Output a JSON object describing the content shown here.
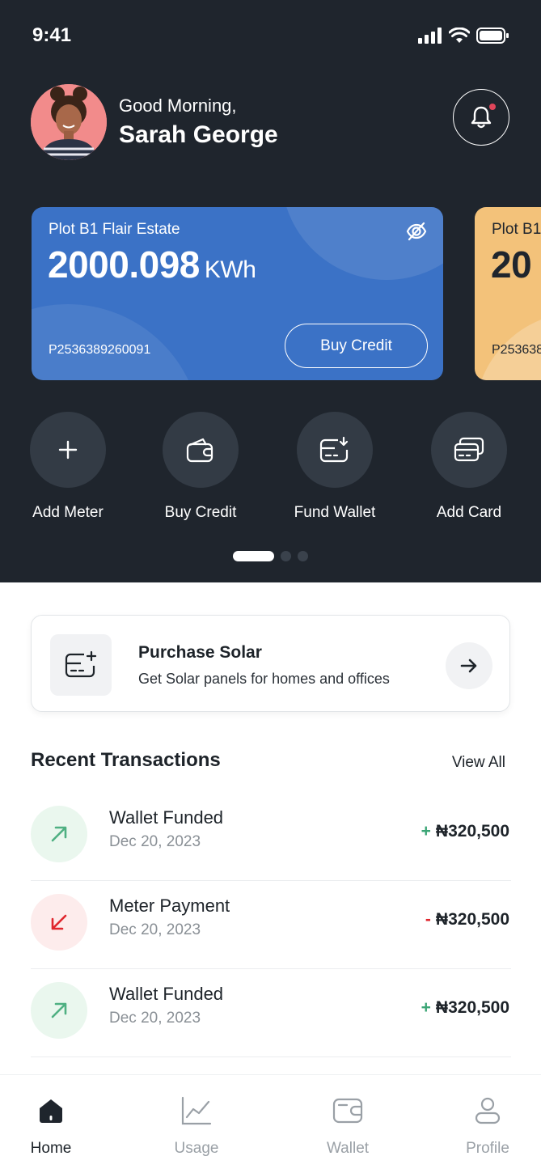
{
  "status_bar": {
    "time": "9:41"
  },
  "header": {
    "greeting": "Good Morning,",
    "user_name": "Sarah George"
  },
  "cards": [
    {
      "plot": "Plot B1 Flair Estate",
      "amount": "2000.098",
      "unit": "KWh",
      "meter_id": "P2536389260091",
      "button_label": "Buy Credit",
      "color": "#3b72c6"
    },
    {
      "plot": "Plot B1",
      "amount": "20",
      "meter_id": "P253638",
      "color": "#f3c27a"
    }
  ],
  "quick_actions": [
    {
      "label": "Add Meter",
      "icon": "plus-icon"
    },
    {
      "label": "Buy Credit",
      "icon": "wallet-icon"
    },
    {
      "label": "Fund Wallet",
      "icon": "card-download-icon"
    },
    {
      "label": "Add Card",
      "icon": "cards-icon"
    }
  ],
  "pager": {
    "pages": 3,
    "active_index": 0
  },
  "promo": {
    "title": "Purchase Solar",
    "subtitle": "Get Solar panels for homes and offices",
    "icon": "card-add-icon"
  },
  "transactions_section": {
    "title": "Recent Transactions",
    "view_all": "View All",
    "items": [
      {
        "title": "Wallet Funded",
        "date": "Dec 20, 2023",
        "sign": "+",
        "amount": "₦320,500",
        "direction": "in"
      },
      {
        "title": "Meter Payment",
        "date": "Dec 20, 2023",
        "sign": "-",
        "amount": "₦320,500",
        "direction": "out"
      },
      {
        "title": "Wallet Funded",
        "date": "Dec 20, 2023",
        "sign": "+",
        "amount": "₦320,500",
        "direction": "in"
      }
    ]
  },
  "tabbar": {
    "items": [
      {
        "label": "Home",
        "icon": "home-icon",
        "active": true
      },
      {
        "label": "Usage",
        "icon": "chart-icon",
        "active": false
      },
      {
        "label": "Wallet",
        "icon": "wallet-icon",
        "active": false
      },
      {
        "label": "Profile",
        "icon": "user-icon",
        "active": false
      }
    ]
  },
  "colors": {
    "header_bg": "#1f252d",
    "accent_blue": "#3b72c6",
    "positive": "#3aa575",
    "negative": "#e0262d"
  }
}
